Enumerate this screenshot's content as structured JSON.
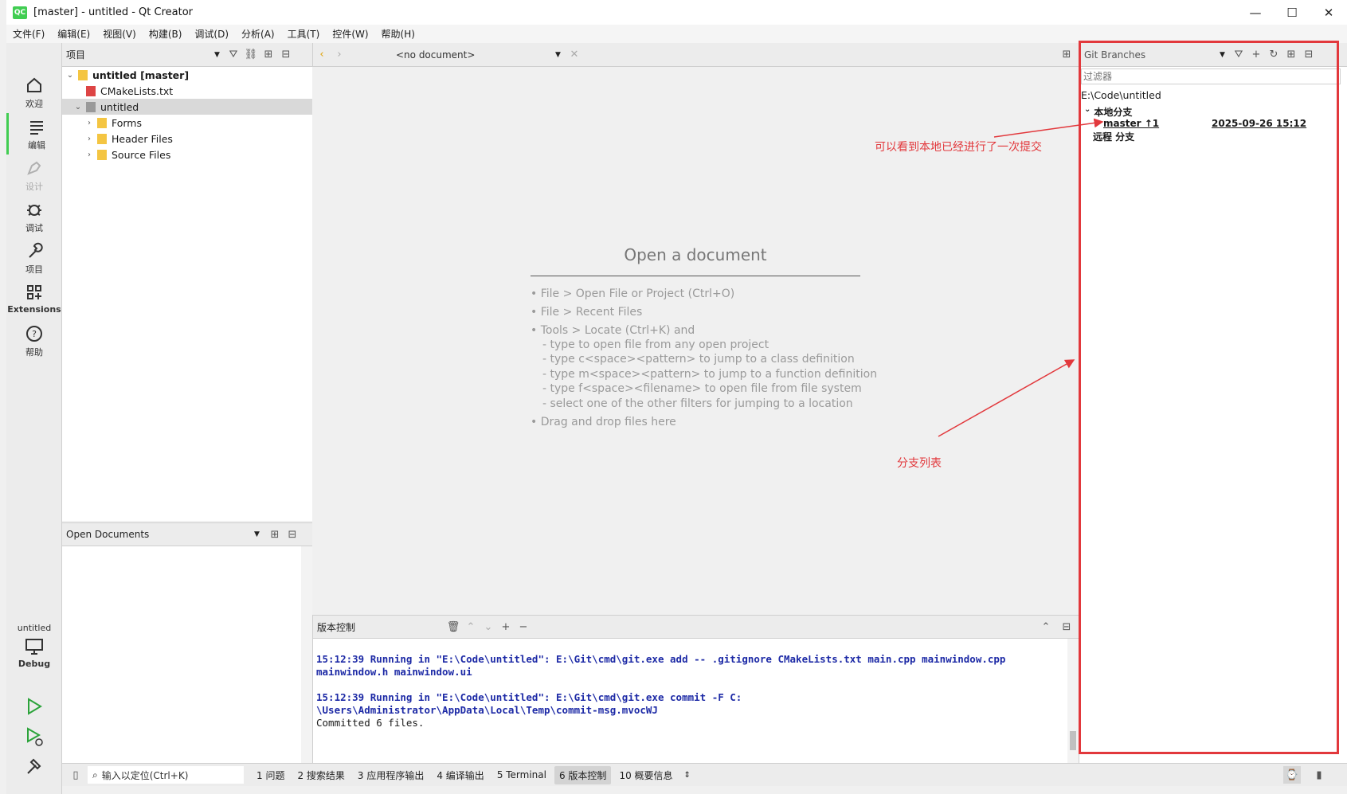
{
  "window": {
    "title": "[master] - untitled - Qt Creator",
    "logo_text": "QC",
    "minimize": "—",
    "maximize": "☐",
    "close": "✕"
  },
  "menu": [
    "文件(F)",
    "编辑(E)",
    "视图(V)",
    "构建(B)",
    "调试(D)",
    "分析(A)",
    "工具(T)",
    "控件(W)",
    "帮助(H)"
  ],
  "modes": {
    "welcome": "欢迎",
    "edit": "编辑",
    "design": "设计",
    "debug": "调试",
    "projects": "项目",
    "extensions": "Extensions",
    "help": "帮助"
  },
  "kit": {
    "project": "untitled",
    "build": "Debug"
  },
  "projects_panel": {
    "selector": "项目",
    "tree": [
      {
        "label": "untitled [master]"
      },
      {
        "label": "CMakeLists.txt"
      },
      {
        "label": "untitled"
      },
      {
        "label": "Forms"
      },
      {
        "label": "Header Files"
      },
      {
        "label": "Source Files"
      }
    ]
  },
  "open_documents": {
    "title": "Open Documents"
  },
  "editor": {
    "doc_selector": "<no document>",
    "title": "Open a document",
    "hints": [
      "• File > Open File or Project (Ctrl+O)",
      "• File > Recent Files",
      "• Tools > Locate (Ctrl+K) and",
      "- type to open file from any open project",
      "- type c<space><pattern> to jump to a class definition",
      "- type m<space><pattern> to jump to a function definition",
      "- type f<space><filename> to open file from file system",
      "- select one of the other filters for jumping to a location",
      "• Drag and drop files here"
    ]
  },
  "version_control": {
    "title": "版本控制",
    "lines": [
      {
        "text": "15:12:39 Running in \"E:\\Code\\untitled\": E:\\Git\\cmd\\git.exe add -- .gitignore CMakeLists.txt main.cpp mainwindow.cpp",
        "style": "blue"
      },
      {
        "text": "mainwindow.h mainwindow.ui",
        "style": "blue"
      },
      {
        "text": "",
        "style": "plain"
      },
      {
        "text": "15:12:39 Running in \"E:\\Code\\untitled\": E:\\Git\\cmd\\git.exe commit -F C:",
        "style": "blue"
      },
      {
        "text": "\\Users\\Administrator\\AppData\\Local\\Temp\\commit-msg.mvocWJ",
        "style": "blue"
      },
      {
        "text": "Committed 6 files.",
        "style": "plain"
      }
    ]
  },
  "git_branches": {
    "selector": "Git Branches",
    "filter_placeholder": "过滤器",
    "repo_path": "E:\\Code\\untitled",
    "local_group": "本地分支",
    "branch_name": "master ↑1",
    "branch_date": "2025-09-26 15:12",
    "remote_group": "远程 分支"
  },
  "annotations": {
    "commit_note": "可以看到本地已经进行了一次提交",
    "branch_list_note": "分支列表"
  },
  "statusbar": {
    "locator_placeholder": "输入以定位(Ctrl+K)",
    "tabs": [
      "1 问题",
      "2 搜索结果",
      "3 应用程序输出",
      "4 编译输出",
      "5 Terminal",
      "6 版本控制",
      "10 概要信息"
    ],
    "selected_tab_index": 5
  },
  "colors": {
    "accent_green": "#41cd52",
    "annotation_red": "#e2383c",
    "log_blue": "#1d2aa6"
  }
}
